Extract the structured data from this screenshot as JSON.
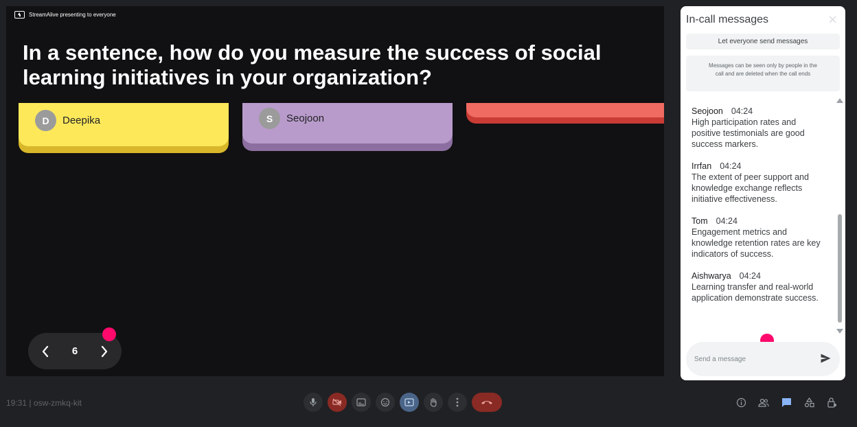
{
  "presentation": {
    "presenting_label": "StreamAlive presenting to everyone",
    "question": "In a sentence, how do you measure the success of social learning initiatives in your organization?",
    "cards": [
      {
        "initial": "D",
        "name": "Deepika",
        "color": "#fde85a"
      },
      {
        "initial": "S",
        "name": "Seojoon",
        "color": "#b89bcb"
      },
      {
        "color": "#f06b62"
      }
    ],
    "pager": {
      "page": "6"
    }
  },
  "panel": {
    "title": "In-call messages",
    "toggle_label": "Let everyone send messages",
    "notice": "Messages can be seen only by people in the call and are deleted when the call ends",
    "messages": [
      {
        "author": "Seojoon",
        "time": "04:24",
        "text": "High participation rates and positive testimonials are good success markers."
      },
      {
        "author": "Irrfan",
        "time": "04:24",
        "text": "The extent of peer support and knowledge exchange reflects initiative effectiveness."
      },
      {
        "author": "Tom",
        "time": "04:24",
        "text": "Engagement metrics and knowledge retention rates are key indicators of success."
      },
      {
        "author": "Aishwarya",
        "time": "04:24",
        "text": "Learning transfer and real-world application demonstrate success."
      }
    ],
    "compose_placeholder": "Send a message"
  },
  "bottom_bar": {
    "meeting_info": "19:31 | osw-zmkq-kit"
  },
  "colors": {
    "accent_dot": "#ff0a6c",
    "hangup": "#8a2a24"
  }
}
